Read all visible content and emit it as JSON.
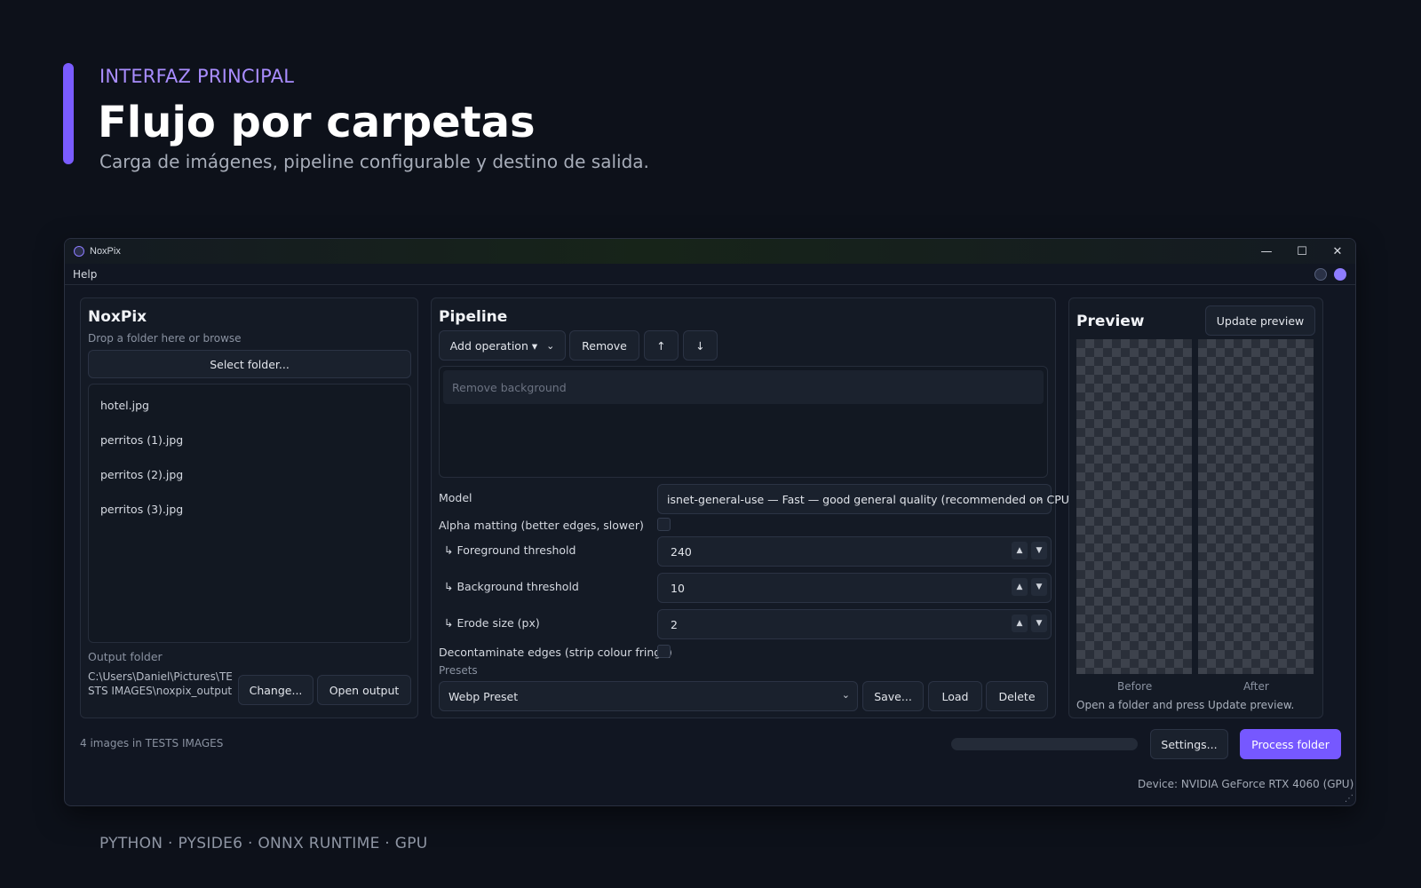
{
  "slide": {
    "eyebrow": "INTERFAZ PRINCIPAL",
    "title": "Flujo por carpetas",
    "subtitle": "Carga de imágenes, pipeline configurable y destino de salida.",
    "tech_stack": "PYTHON · PYSIDE6 · ONNX RUNTIME · GPU"
  },
  "window": {
    "title": "NoxPix",
    "minimize": "—",
    "maximize": "☐",
    "close": "✕"
  },
  "menubar": {
    "help": "Help"
  },
  "left_panel": {
    "title": "NoxPix",
    "hint": "Drop a folder here or browse",
    "select_folder": "Select folder...",
    "files": [
      "hotel.jpg",
      "perritos (1).jpg",
      "perritos (2).jpg",
      "perritos (3).jpg"
    ],
    "output_label": "Output folder",
    "output_path": "C:\\Users\\Daniel\\Pictures\\TESTS IMAGES\\noxpix_output",
    "change": "Change...",
    "open_output": "Open output"
  },
  "pipeline": {
    "title": "Pipeline",
    "add_operation": "Add operation ▾",
    "remove": "Remove",
    "up": "↑",
    "down": "↓",
    "operations": [
      "Remove background"
    ],
    "model_label": "Model",
    "model_value": "isnet-general-use — Fast — good general quality (recommended on CPU)",
    "alpha_matting_label": "Alpha matting (better edges, slower)",
    "alpha_matting_checked": false,
    "fg_label": "↳ Foreground threshold",
    "fg_value": "240",
    "bg_label": "↳ Background threshold",
    "bg_value": "10",
    "erode_label": "↳ Erode size (px)",
    "erode_value": "2",
    "decontaminate_label": "Decontaminate edges (strip colour fringe)",
    "decontaminate_checked": false,
    "presets_label": "Presets",
    "preset_value": "Webp Preset",
    "save": "Save...",
    "load": "Load",
    "delete": "Delete"
  },
  "preview": {
    "title": "Preview",
    "update": "Update preview",
    "before": "Before",
    "after": "After",
    "hint": "Open a folder and press Update preview."
  },
  "footer": {
    "status": "4 images in TESTS IMAGES",
    "progress": 0,
    "settings": "Settings...",
    "process": "Process folder",
    "device": "Device: NVIDIA GeForce RTX 4060 (GPU)"
  },
  "colors": {
    "accent": "#7658ff",
    "eyebrow": "#a98dff",
    "background": "#0d111a"
  }
}
